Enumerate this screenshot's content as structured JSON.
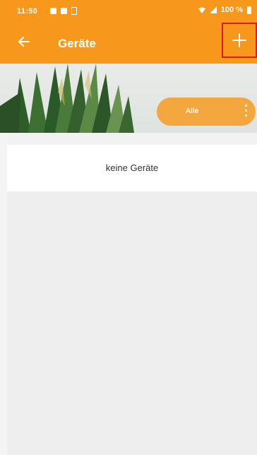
{
  "status_bar": {
    "time": "11:50",
    "battery": "100 %"
  },
  "app_bar": {
    "title": "Geräte",
    "back_icon": "arrow-left-icon",
    "add_icon": "plus-icon"
  },
  "filter": {
    "label": "Alle",
    "menu_icon": "more-vertical-icon"
  },
  "devices": {
    "empty_text": "keine Geräte"
  },
  "colors": {
    "accent": "#f7981d",
    "pill": "#f4a63f",
    "highlight": "#e01b1b"
  }
}
